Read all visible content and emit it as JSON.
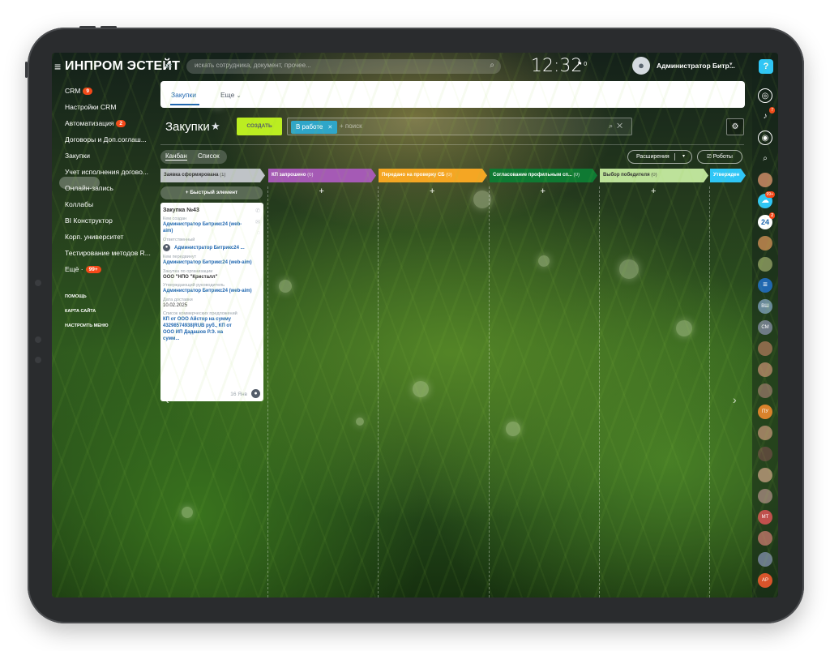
{
  "header": {
    "brand": "ИНПРОМ ЭСТЕЙТ",
    "search_placeholder": "искать сотрудника, документ, прочее...",
    "time": "12:32",
    "flag_count": "0",
    "user_name": "Администратор Битр..."
  },
  "sidebar": {
    "items": [
      {
        "label": "CRM",
        "badge": "9"
      },
      {
        "label": "Настройки CRM",
        "badge": ""
      },
      {
        "label": "Автоматизация",
        "badge": "2"
      },
      {
        "label": "Договоры и Доп.соглаш...",
        "badge": ""
      },
      {
        "label": "Закупки",
        "badge": ""
      },
      {
        "label": "Учет исполнения догово...",
        "badge": ""
      },
      {
        "label": "Онлайн-запись",
        "badge": ""
      },
      {
        "label": "Коллабы",
        "badge": ""
      },
      {
        "label": "BI Конструктор",
        "badge": ""
      },
      {
        "label": "Корп. университет",
        "badge": ""
      },
      {
        "label": "Тестирование методов R...",
        "badge": ""
      },
      {
        "label": "Ещё ·",
        "badge": "99+"
      }
    ],
    "footer_links": [
      "ПОМОЩЬ",
      "КАРТА САЙТА",
      "НАСТРОИТЬ МЕНЮ"
    ]
  },
  "tabs": [
    "Закупки",
    "Еще"
  ],
  "page": {
    "title": "Закупки",
    "create_label": "СОЗДАТЬ",
    "filter_chip": "В работе",
    "filter_placeholder": "+ поиск"
  },
  "view": {
    "kanban": "Канбан",
    "list": "Список",
    "extensions": "Расширения",
    "robots": "Роботы"
  },
  "kanban": {
    "quick_add": "Быстрый элемент",
    "stages": [
      {
        "name": "Заявка сформирована",
        "count": "(1)",
        "color": "#bfc3c7",
        "text": "#333333"
      },
      {
        "name": "КП запрошено",
        "count": "(0)",
        "color": "#a55ab5",
        "text": "#ffffff"
      },
      {
        "name": "Передано на проверку СБ",
        "count": "(0)",
        "color": "#f5a623",
        "text": "#ffffff"
      },
      {
        "name": "Согласование профильным сп...",
        "count": "(0)",
        "color": "#0f7a33",
        "text": "#ffffff"
      },
      {
        "name": "Выбор победителя",
        "count": "(0)",
        "color": "#bde29a",
        "text": "#333333"
      },
      {
        "name": "Утвержден",
        "count": "",
        "color": "#2fc6f6",
        "text": "#ffffff"
      }
    ],
    "card": {
      "title": "Закупка №43",
      "created_by_label": "Кем создан",
      "created_by": "Администратор Битрикс24 (web-aim)",
      "responsible_label": "Ответственный",
      "responsible": "Администратор Битрикс24 ...",
      "transferred_label": "Кем передвинут",
      "transferred_by": "Администратор Битрикс24 (web-aim)",
      "org_label": "Закупка по организации",
      "org": "ООО \"НПО \"Кристалл\"",
      "approver_label": "Утверждающий руководитель",
      "approver": "Администратор Битрикс24 (web-aim)",
      "delivery_label": "Дата доставки",
      "delivery": "10.02.2025",
      "offers_label": "Список коммерческих предложений",
      "offers": "КП от ООО Айстор на сумму 43298574938|RUB руб., КП от ООО ИП Дадашов Р.Э. на сумм...",
      "date": "16 Янв"
    }
  },
  "right_panel": {
    "badges": [
      "7",
      "99+",
      "2"
    ],
    "labels": [
      "24",
      "ВШ",
      "СМ",
      "ПУ",
      "МТ",
      "АР"
    ]
  }
}
